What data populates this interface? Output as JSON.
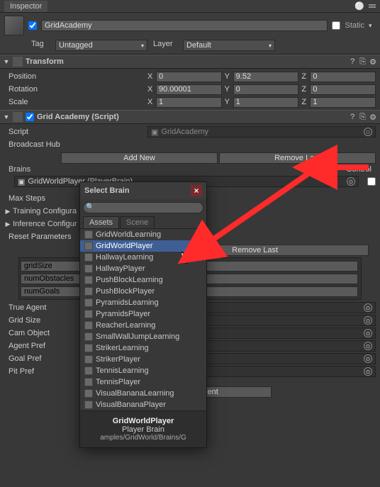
{
  "header": {
    "title": "Inspector"
  },
  "gameObject": {
    "enabled": true,
    "name": "GridAcademy",
    "static_label": "Static",
    "tag_label": "Tag",
    "tag_value": "Untagged",
    "layer_label": "Layer",
    "layer_value": "Default"
  },
  "transform": {
    "title": "Transform",
    "rows": {
      "position": {
        "label": "Position",
        "x": "0",
        "y": "9.52",
        "z": "0"
      },
      "rotation": {
        "label": "Rotation",
        "x": "90.00001",
        "y": "0",
        "z": "0"
      },
      "scale": {
        "label": "Scale",
        "x": "1",
        "y": "1",
        "z": "1"
      }
    }
  },
  "academy": {
    "title": "Grid Academy (Script)",
    "script_label": "Script",
    "script_value": "GridAcademy",
    "broadcast_hub_label": "Broadcast Hub",
    "add_new": "Add New",
    "remove_last": "Remove Last",
    "brains_label": "Brains",
    "control_label": "Control",
    "brain_items": [
      {
        "name": "GridWorldPlayer (PlayerBrain)"
      }
    ],
    "max_steps_label": "Max Steps",
    "training_config_label": "Training Configura",
    "inference_config_label": "Inference Configur",
    "reset_params_label": "Reset Parameters",
    "reset_add_new": "Add New",
    "reset_remove_last": "Remove Last",
    "reset_items": [
      {
        "name": "gridSize"
      },
      {
        "name": "numObstacles"
      },
      {
        "name": "numGoals"
      }
    ],
    "fields": [
      {
        "label": "True Agent"
      },
      {
        "label": "Grid Size"
      },
      {
        "label": "Cam Object"
      },
      {
        "label": "Agent Pref"
      },
      {
        "label": "Goal Pref"
      },
      {
        "label": "Pit Pref"
      }
    ]
  },
  "add_component": "Add Component",
  "popup": {
    "title": "Select Brain",
    "search_value": "",
    "tabs": {
      "assets": "Assets",
      "scene": "Scene"
    },
    "items": [
      "GridWorldLearning",
      "GridWorldPlayer",
      "HallwayLearning",
      "HallwayPlayer",
      "PushBlockLearning",
      "PushBlockPlayer",
      "PyramidsLearning",
      "PyramidsPlayer",
      "ReacherLearning",
      "SmallWallJumpLearning",
      "StrikerLearning",
      "StrikerPlayer",
      "TennisLearning",
      "TennisPlayer",
      "VisualBananaLearning",
      "VisualBananaPlayer"
    ],
    "selected_index": 1,
    "footer": {
      "name": "GridWorldPlayer",
      "type": "Player Brain",
      "path": "amples/GridWorld/Brains/G"
    }
  }
}
